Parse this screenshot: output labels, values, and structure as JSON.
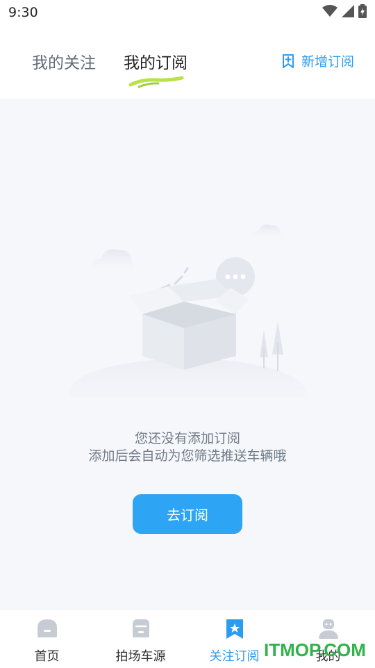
{
  "status_bar": {
    "time": "9:30"
  },
  "header": {
    "tabs": [
      {
        "label": "我的关注",
        "active": false
      },
      {
        "label": "我的订阅",
        "active": true
      }
    ],
    "add_subscription_label": "新增订阅",
    "accent_color": "#2f9bee"
  },
  "empty_state": {
    "line1": "您还没有添加订阅",
    "line2": "添加后会自动为您筛选推送车辆哦",
    "button_label": "去订阅"
  },
  "bottom_nav": {
    "items": [
      {
        "label": "首页",
        "icon": "home-icon",
        "active": false
      },
      {
        "label": "拍场车源",
        "icon": "car-icon",
        "active": false
      },
      {
        "label": "关注订阅",
        "icon": "bookmark-star-icon",
        "active": true
      },
      {
        "label": "我的",
        "icon": "profile-icon",
        "active": false
      }
    ]
  },
  "watermark": "ITMOP.COM"
}
